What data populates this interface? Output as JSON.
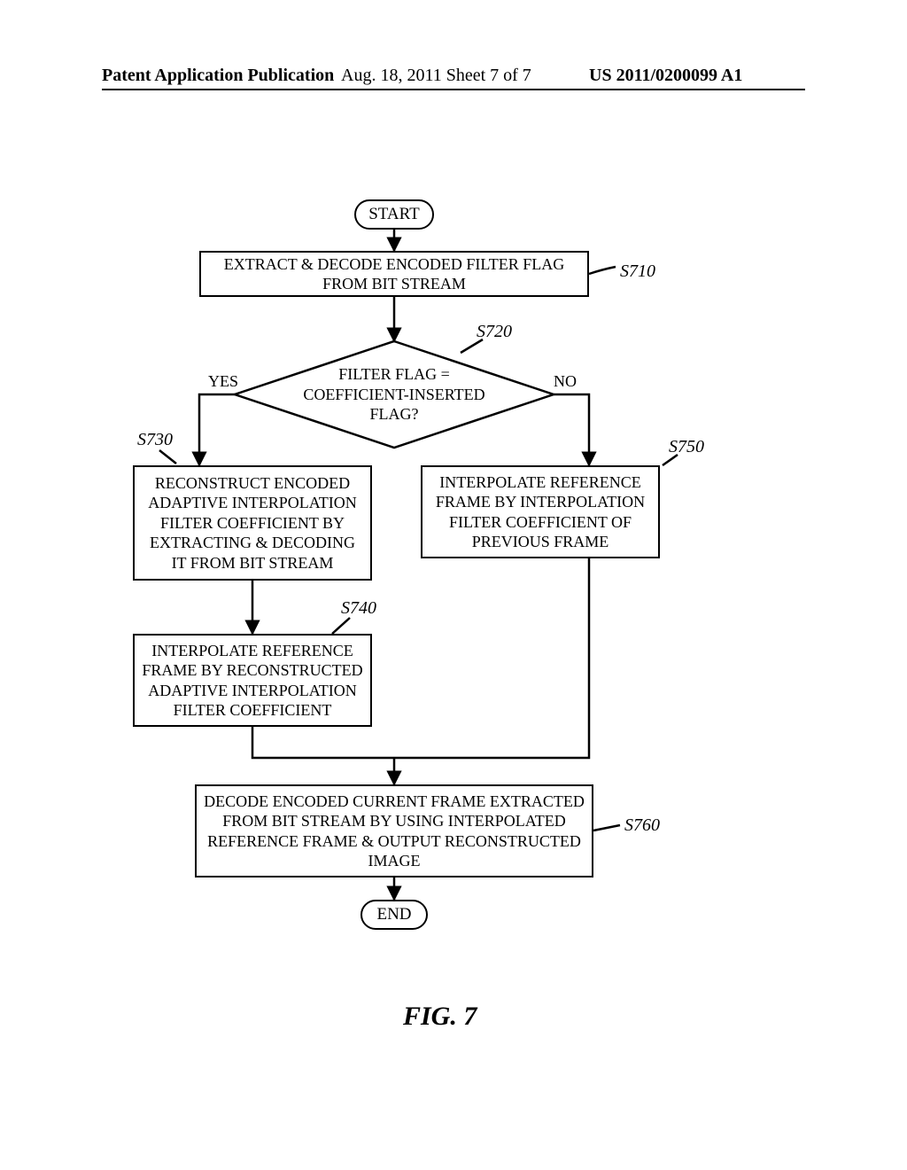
{
  "header": {
    "left": "Patent Application Publication",
    "mid": "Aug. 18, 2011  Sheet 7 of 7",
    "right": "US 2011/0200099 A1"
  },
  "diagram": {
    "start": "START",
    "end": "END",
    "s710": "EXTRACT & DECODE ENCODED FILTER FLAG FROM BIT STREAM",
    "s720": "FILTER FLAG = COEFFICIENT-INSERTED FLAG?",
    "s730": "RECONSTRUCT ENCODED ADAPTIVE INTERPOLATION FILTER COEFFICIENT BY EXTRACTING & DECODING IT FROM BIT STREAM",
    "s740": "INTERPOLATE REFERENCE FRAME BY RECONSTRUCTED ADAPTIVE INTERPOLATION FILTER COEFFICIENT",
    "s750": "INTERPOLATE REFERENCE FRAME BY INTERPOLATION FILTER COEFFICIENT OF PREVIOUS FRAME",
    "s760": "DECODE ENCODED CURRENT FRAME EXTRACTED FROM BIT STREAM BY USING INTERPOLATED REFERENCE FRAME & OUTPUT RECONSTRUCTED IMAGE",
    "labels": {
      "s710": "S710",
      "s720": "S720",
      "s730": "S730",
      "s740": "S740",
      "s750": "S750",
      "s760": "S760"
    },
    "yes": "YES",
    "no": "NO",
    "fig": "FIG. 7"
  },
  "chart_data": {
    "type": "flowchart",
    "nodes": [
      {
        "id": "START",
        "kind": "terminator",
        "text": "START"
      },
      {
        "id": "S710",
        "kind": "process",
        "text": "EXTRACT & DECODE ENCODED FILTER FLAG FROM BIT STREAM"
      },
      {
        "id": "S720",
        "kind": "decision",
        "text": "FILTER FLAG = COEFFICIENT-INSERTED FLAG?"
      },
      {
        "id": "S730",
        "kind": "process",
        "text": "RECONSTRUCT ENCODED ADAPTIVE INTERPOLATION FILTER COEFFICIENT BY EXTRACTING & DECODING IT FROM BIT STREAM"
      },
      {
        "id": "S740",
        "kind": "process",
        "text": "INTERPOLATE REFERENCE FRAME BY RECONSTRUCTED ADAPTIVE INTERPOLATION FILTER COEFFICIENT"
      },
      {
        "id": "S750",
        "kind": "process",
        "text": "INTERPOLATE REFERENCE FRAME BY INTERPOLATION FILTER COEFFICIENT OF PREVIOUS FRAME"
      },
      {
        "id": "S760",
        "kind": "process",
        "text": "DECODE ENCODED CURRENT FRAME EXTRACTED FROM BIT STREAM BY USING INTERPOLATED REFERENCE FRAME & OUTPUT RECONSTRUCTED IMAGE"
      },
      {
        "id": "END",
        "kind": "terminator",
        "text": "END"
      }
    ],
    "edges": [
      {
        "from": "START",
        "to": "S710"
      },
      {
        "from": "S710",
        "to": "S720"
      },
      {
        "from": "S720",
        "to": "S730",
        "label": "YES"
      },
      {
        "from": "S720",
        "to": "S750",
        "label": "NO"
      },
      {
        "from": "S730",
        "to": "S740"
      },
      {
        "from": "S740",
        "to": "S760"
      },
      {
        "from": "S750",
        "to": "S760"
      },
      {
        "from": "S760",
        "to": "END"
      }
    ],
    "title": "FIG. 7"
  }
}
